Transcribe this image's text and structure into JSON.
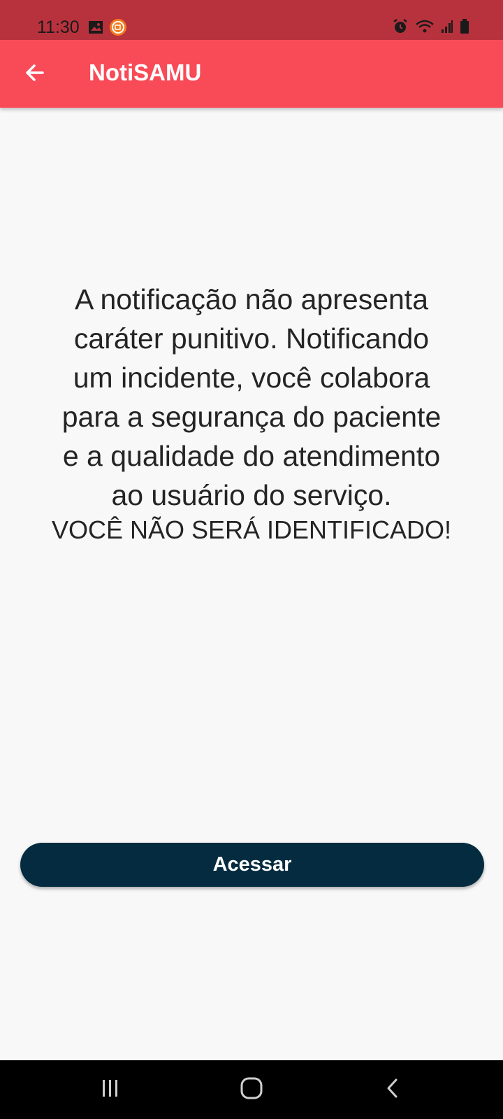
{
  "status_bar": {
    "time": "11:30",
    "icons_left": [
      "image-icon",
      "screen-recorder-icon"
    ],
    "icons_right": [
      "alarm-icon",
      "wifi-icon",
      "signal-icon",
      "battery-icon"
    ]
  },
  "app_bar": {
    "title": "NotiSAMU",
    "back_icon": "arrow-left-icon",
    "color": "#f94a57"
  },
  "notice": {
    "lines": [
      "A notificação não apresenta",
      "caráter punitivo. Notificando",
      "um incidente, você colabora",
      "para a segurança do paciente",
      "e a qualidade do atendimento",
      "ao usuário do serviço."
    ],
    "warning": "VOCÊ NÃO SERÁ IDENTIFICADO!"
  },
  "access_button": {
    "label": "Acessar",
    "color": "#042b3f"
  },
  "nav_bar": {
    "buttons": [
      "recent-apps-icon",
      "home-icon",
      "back-icon"
    ]
  }
}
